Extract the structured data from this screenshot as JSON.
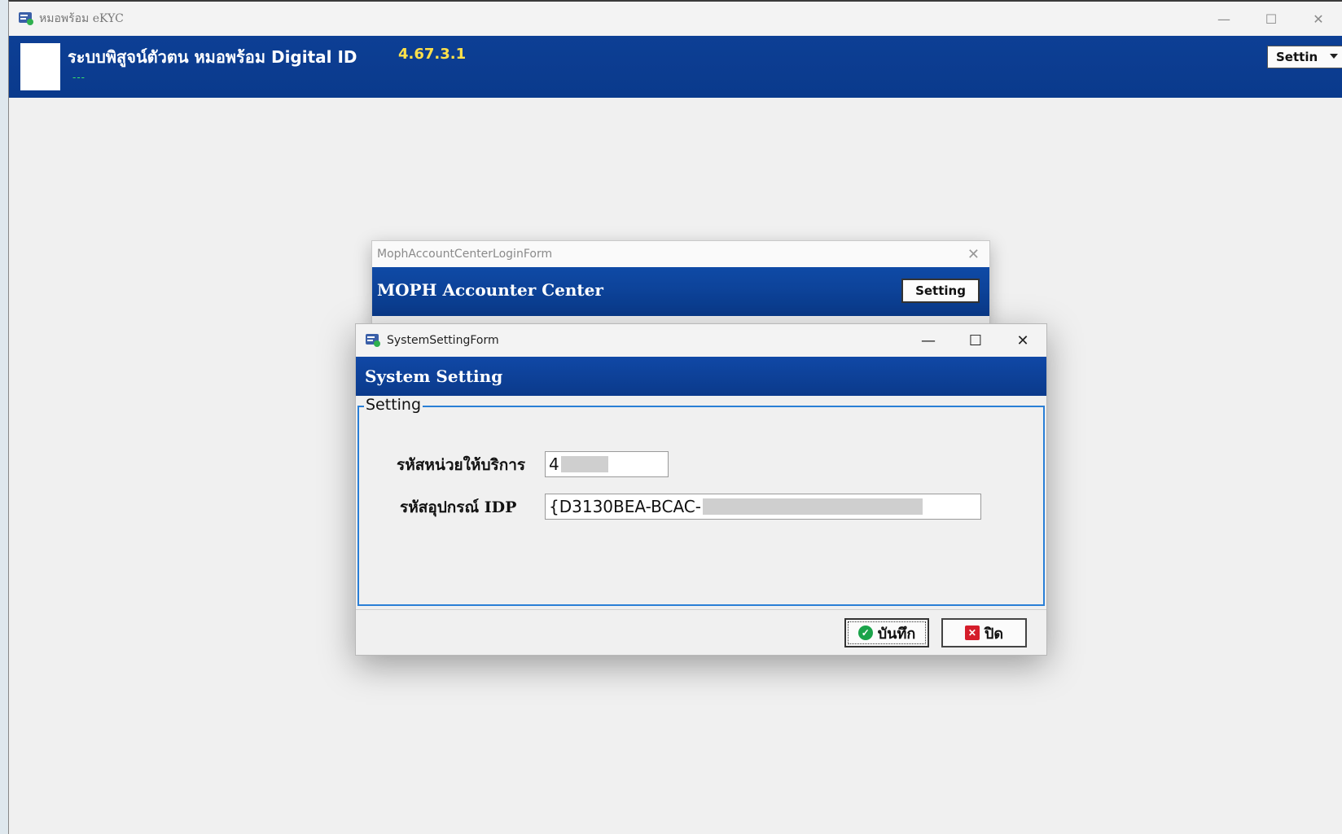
{
  "main_window": {
    "title": "หมอพร้อม eKYC",
    "heading": "ระบบพิสูจน์ตัวตน หมอพร้อม Digital ID",
    "version": "4.67.3.1",
    "status": "---",
    "setting_dropdown": "Settin",
    "controls": {
      "minimize": "—",
      "maximize": "☐",
      "close": "✕"
    }
  },
  "login_form": {
    "title": "MophAccountCenterLoginForm",
    "heading": "MOPH  Accounter Center",
    "setting_button": "Setting",
    "close": "✕"
  },
  "system_setting_dialog": {
    "title": "SystemSettingForm",
    "heading": "System Setting",
    "controls": {
      "minimize": "—",
      "maximize": "☐",
      "close": "✕"
    },
    "group_label": "Setting",
    "fields": [
      {
        "label": "รหัสหน่วยให้บริการ",
        "value": "4"
      },
      {
        "label": "รหัสอุปกรณ์ IDP",
        "value": "{D3130BEA-BCAC-"
      }
    ],
    "buttons": {
      "save": "บันทึก",
      "close": "ปิด"
    }
  },
  "colors": {
    "header_blue": "#0a3a8c",
    "version_yellow": "#ffe14a",
    "status_green": "#38e86a",
    "group_border": "#2a7fd6"
  }
}
